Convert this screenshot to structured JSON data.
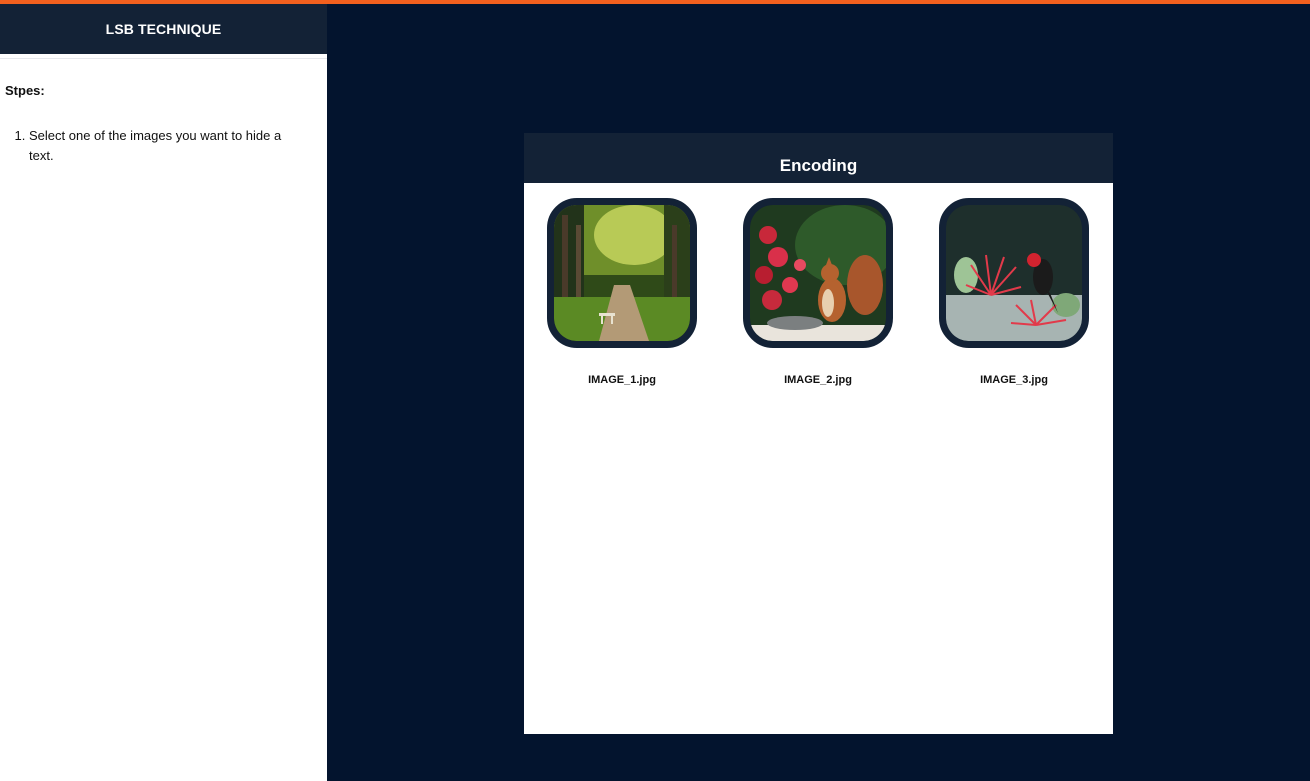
{
  "sidebar": {
    "title": "LSB TECHNIQUE",
    "steps_title": "Stpes:",
    "steps": [
      "Select one of the images you want to hide a text."
    ]
  },
  "panel": {
    "title": "Encoding",
    "images": [
      {
        "label": "IMAGE_1.jpg",
        "depicts": "forest path with bench"
      },
      {
        "label": "IMAGE_2.jpg",
        "depicts": "squirrel with red flowers"
      },
      {
        "label": "IMAGE_3.jpg",
        "depicts": "red bird with red flowers"
      }
    ]
  },
  "colors": {
    "accent": "#f2601e",
    "background": "#03142e",
    "header": "#132236"
  }
}
